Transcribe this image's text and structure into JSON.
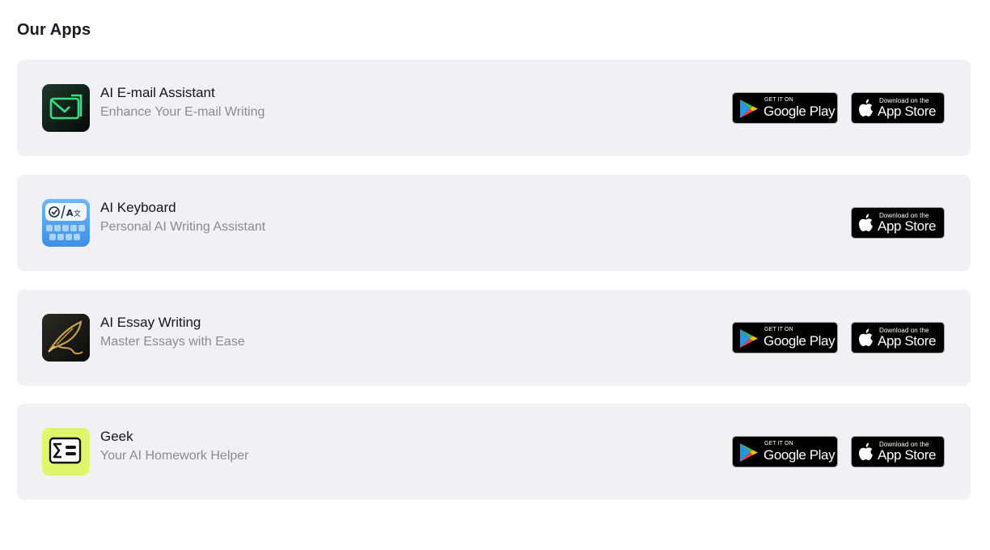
{
  "section": {
    "title": "Our Apps"
  },
  "apps": [
    {
      "name": "AI E-mail Assistant",
      "tagline": "Enhance Your E-mail Writing",
      "icon": "email-assistant-app-icon",
      "stores": [
        "google-play",
        "app-store"
      ]
    },
    {
      "name": "AI Keyboard",
      "tagline": "Personal AI Writing Assistant",
      "icon": "ai-keyboard-app-icon",
      "stores": [
        "app-store"
      ]
    },
    {
      "name": "AI Essay Writing",
      "tagline": "Master Essays with Ease",
      "icon": "essay-quill-app-icon",
      "stores": [
        "google-play",
        "app-store"
      ]
    },
    {
      "name": "Geek",
      "tagline": "Your AI Homework Helper",
      "icon": "sigma-homework-app-icon",
      "stores": [
        "google-play",
        "app-store"
      ]
    }
  ],
  "badges": {
    "google_play": {
      "small": "GET IT ON",
      "big": "Google Play"
    },
    "app_store": {
      "small": "Download on the",
      "big": "App Store"
    }
  },
  "keyboard_icon_text": "A",
  "colors": {
    "card_background": "#f1f0f5",
    "badge_background": "#000000",
    "tagline_text": "#8a8a93",
    "email_icon_green": "#3ddc84",
    "keyboard_icon_blue": "#5aa8f5",
    "geek_icon_lime": "#dff56a",
    "essay_icon_gold": "#c9a24a"
  }
}
